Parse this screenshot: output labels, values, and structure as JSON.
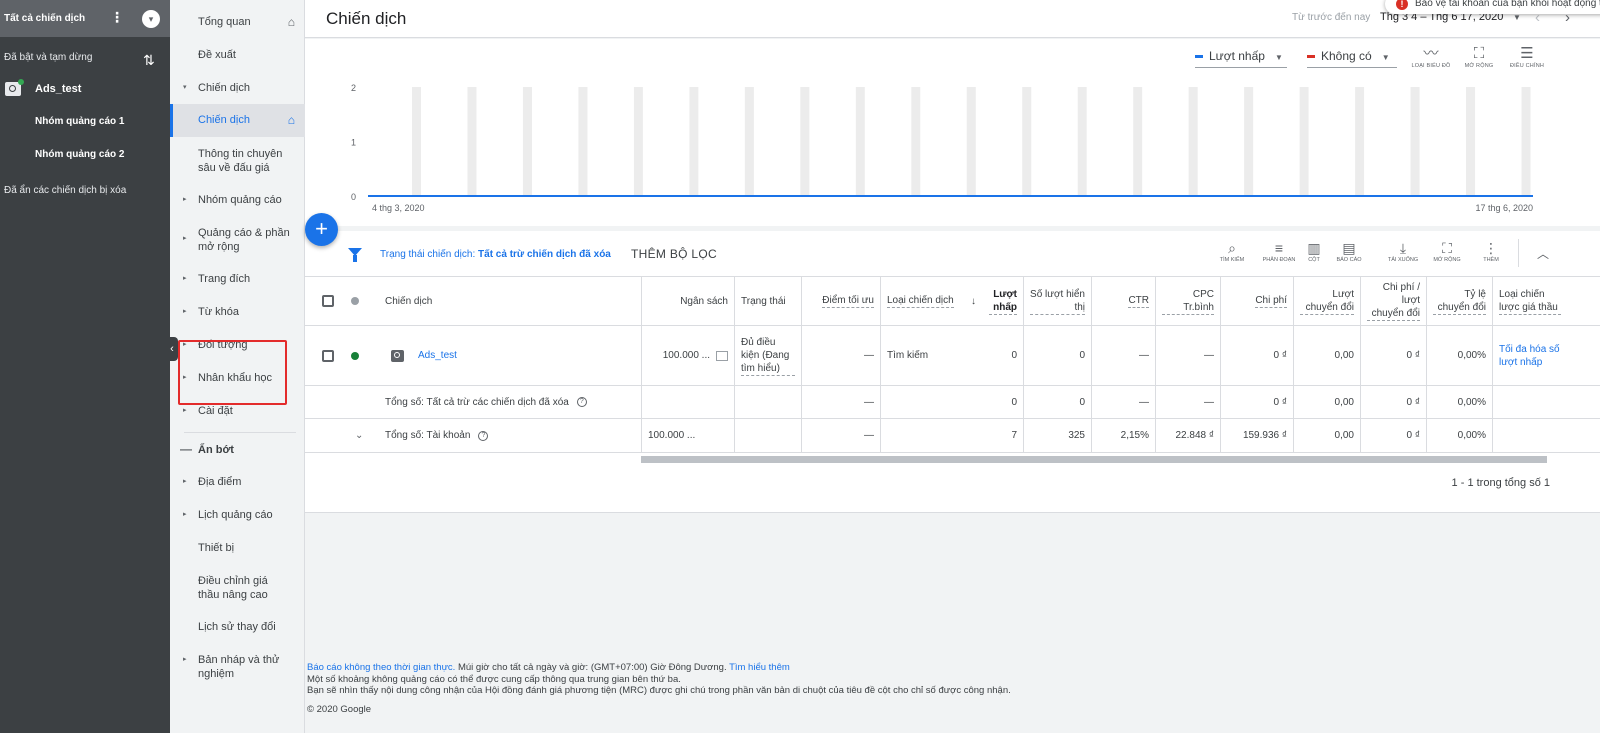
{
  "left_panel": {
    "header_title": "Tất cả chiến dịch",
    "filter_label": "Đã bật và tạm dừng",
    "campaign_name": "Ads_test",
    "ad_groups": [
      "Nhóm quảng cáo 1",
      "Nhóm quảng cáo 2"
    ],
    "hidden_removed": "Đã ẩn các chiến dịch bị xóa"
  },
  "nav": {
    "items": [
      {
        "label": "Tổng quan"
      },
      {
        "label": "Đề xuất"
      },
      {
        "label": "Chiến dịch"
      },
      {
        "label": "Chiến dịch"
      },
      {
        "label": "Thông tin chuyên sâu về đấu giá"
      },
      {
        "label": "Nhóm quảng cáo"
      },
      {
        "label": "Quảng cáo & phần mở rộng"
      },
      {
        "label": "Trang đích"
      },
      {
        "label": "Từ khóa"
      },
      {
        "label": "Đối tượng"
      },
      {
        "label": "Nhân khẩu học"
      },
      {
        "label": "Cài đặt"
      },
      {
        "label": "Ẩn bớt"
      },
      {
        "label": "Địa điểm"
      },
      {
        "label": "Lịch quảng cáo"
      },
      {
        "label": "Thiết bị"
      },
      {
        "label": "Điều chỉnh giá thầu nâng cao"
      },
      {
        "label": "Lịch sử thay đổi"
      },
      {
        "label": "Bản nháp và thử nghiệm"
      }
    ]
  },
  "header": {
    "title": "Chiến dịch",
    "toast": "Bảo vệ tài khoản của bạn khỏi hoạt động trái phép",
    "date_hint": "Từ trước đến nay",
    "date_range": "Thg 3 4 – Thg 6 17, 2020"
  },
  "chart": {
    "metric1": "Lượt nhấp",
    "metric2": "Không có",
    "metric1_color": "#1a73e8",
    "metric2_color": "#d93025",
    "tools": [
      "LOẠI BIỂU ĐỒ",
      "MỞ RỘNG",
      "ĐIỀU CHỈNH"
    ],
    "x_start_label": "4 thg 3, 2020",
    "x_end_label": "17 thg 6, 2020"
  },
  "chart_data": {
    "type": "line",
    "title": "",
    "xlabel": "",
    "ylabel": "",
    "ylim": [
      0,
      2
    ],
    "yticks": [
      "0",
      "1",
      "2"
    ],
    "x_tick_labels": [
      "4 thg 3, 2020",
      "17 thg 6, 2020"
    ],
    "weekend_bands": 21,
    "series": [
      {
        "name": "Lượt nhấp",
        "values": [
          0,
          0,
          0,
          0,
          0,
          0,
          0,
          0,
          0,
          0,
          0,
          0,
          0,
          0,
          0,
          0,
          0,
          0,
          0,
          0,
          0,
          0
        ]
      }
    ],
    "grid": false
  },
  "filters": {
    "status_label": "Trạng thái chiến dịch:",
    "status_value": "Tất cả trừ chiến dịch đã xóa",
    "add_filter": "THÊM BỘ LỌC"
  },
  "table_tools": [
    "TÌM KIẾM",
    "PHÂN ĐOẠN",
    "CỘT",
    "BÁO CÁO",
    "TẢI XUỐNG",
    "MỞ RỘNG",
    "THÊM"
  ],
  "table": {
    "headers": {
      "campaign": "Chiến dịch",
      "budget": "Ngân sách",
      "status": "Trạng thái",
      "opt": "Điểm tối ưu",
      "type": "Loại chiến dịch",
      "clicks": "Lượt nhấp",
      "impr": "Số lượt hiển thị",
      "ctr": "CTR",
      "cpc": "CPC Tr.bình",
      "cost": "Chi phí",
      "conv": "Lượt chuyển đổi",
      "cost_conv": "Chi phí / lượt chuyển đổi",
      "conv_rate": "Tỷ lệ chuyển đổi",
      "bid_strategy": "Loại chiến lược giá thầu"
    },
    "row": {
      "campaign": "Ads_test",
      "budget": "100.000 ...",
      "status": "Đủ điều kiện (Đang tìm hiểu)",
      "opt": "—",
      "type": "Tìm kiếm",
      "clicks": "0",
      "impr": "0",
      "ctr": "—",
      "cpc": "—",
      "cost": "0 ₫",
      "conv": "0,00",
      "cost_conv": "0 ₫",
      "conv_rate": "0,00%",
      "bid_strategy": "Tối đa hóa số lượt nhấp"
    },
    "total_filtered": {
      "label": "Tổng số: Tất cả trừ các chiến dịch đã xóa",
      "opt": "—",
      "clicks": "0",
      "impr": "0",
      "ctr": "—",
      "cpc": "—",
      "cost": "0 ₫",
      "conv": "0,00",
      "cost_conv": "0 ₫",
      "conv_rate": "0,00%"
    },
    "total_account": {
      "label": "Tổng số: Tài khoản",
      "budget": "100.000 ...",
      "opt": "—",
      "clicks": "7",
      "impr": "325",
      "ctr": "2,15%",
      "cpc": "22.848 ₫",
      "cost": "159.936 ₫",
      "conv": "0,00",
      "cost_conv": "0 ₫",
      "conv_rate": "0,00%"
    },
    "paging": "1 - 1 trong tổng số 1"
  },
  "footer": {
    "line1_a": "Báo cáo không theo thời gian thực.",
    "line1_b": " Múi giờ cho tất cả ngày và giờ: (GMT+07:00) Giờ Đông Dương.",
    "line1_link": "Tìm hiểu thêm",
    "line2": "Một số khoảng không quảng cáo có thể được cung cấp thông qua trung gian bên thứ ba.",
    "line3": "Bạn sẽ nhìn thấy nội dung công nhận của Hội đồng đánh giá phương tiện (MRC) được ghi chú trong phần văn bản di chuột của tiêu đề cột cho chỉ số được công nhận.",
    "copyright": "© 2020 Google"
  }
}
